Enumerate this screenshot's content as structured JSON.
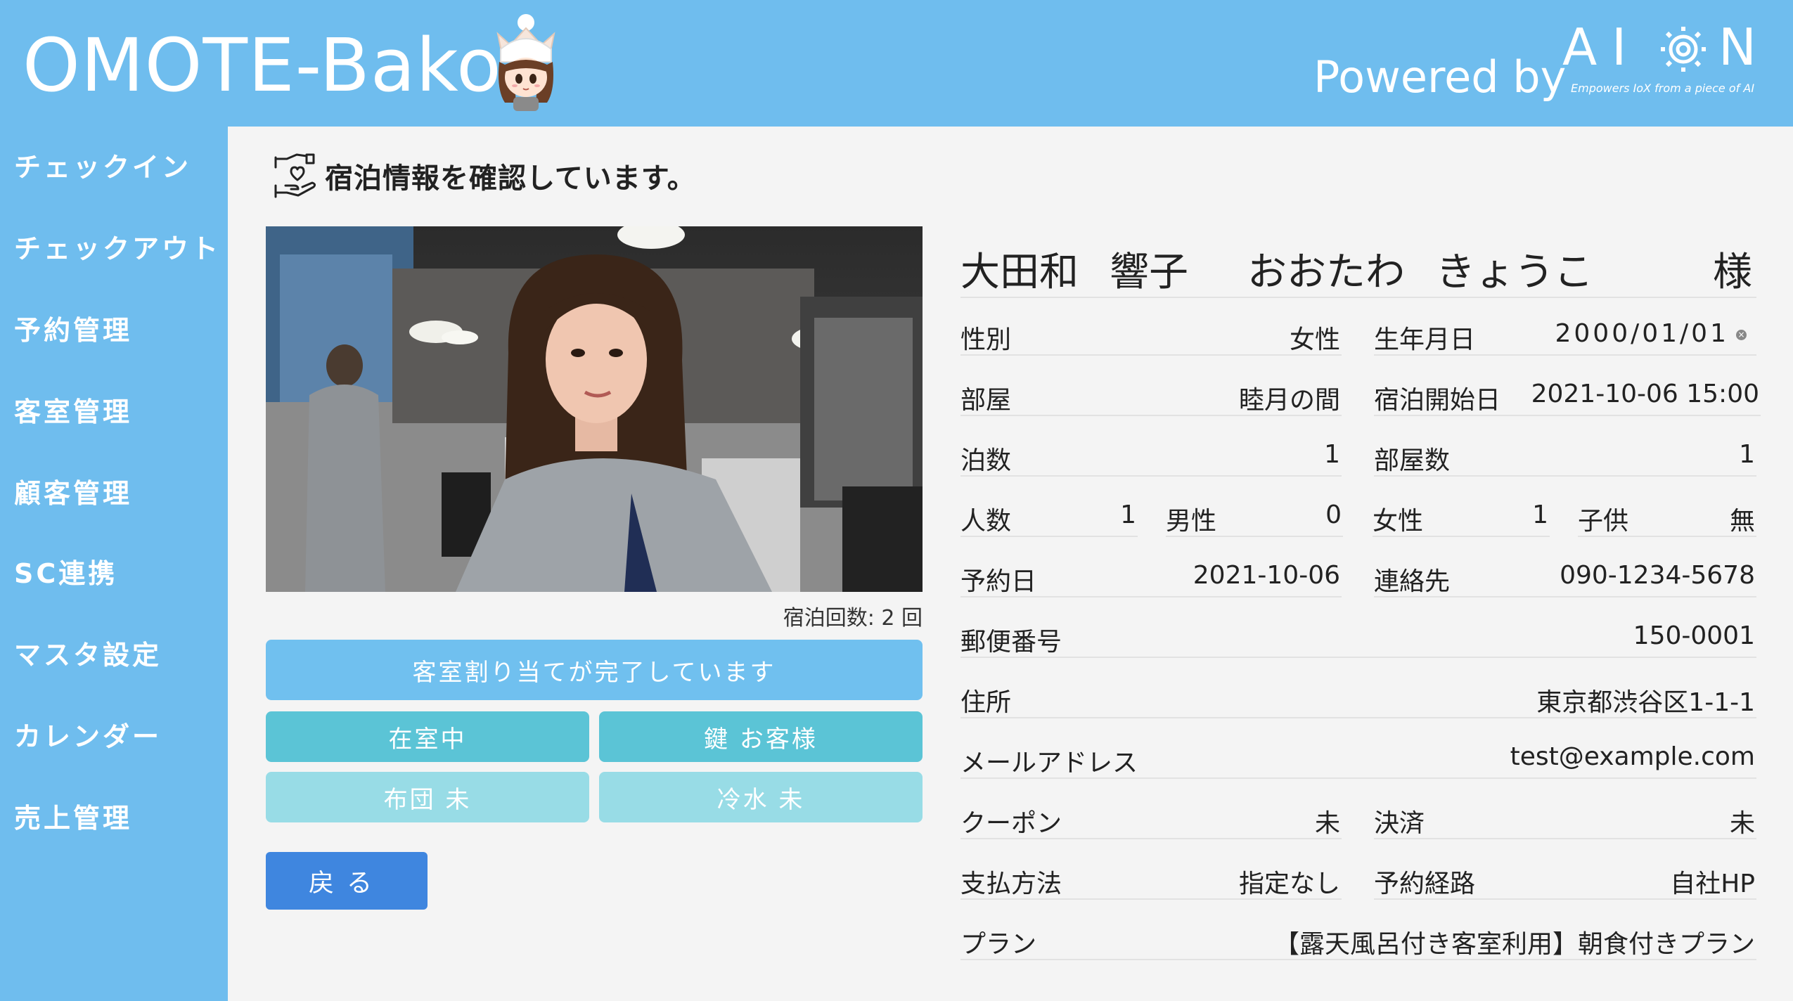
{
  "header": {
    "app_title": "OMOTE-Bako",
    "powered_by": "Powered by",
    "logo_text": "AION",
    "logo_tagline": "Empowers IoX from a piece of AI"
  },
  "sidebar": {
    "items": [
      {
        "label": "チェックイン"
      },
      {
        "label": "チェックアウト"
      },
      {
        "label": "予約管理"
      },
      {
        "label": "客室管理"
      },
      {
        "label": "顧客管理"
      },
      {
        "label": "SC連携"
      },
      {
        "label": "マスタ設定"
      },
      {
        "label": "カレンダー"
      },
      {
        "label": "売上管理"
      }
    ]
  },
  "main": {
    "heading": "宿泊情報を確認しています。",
    "stay_count": "宿泊回数: 2 回",
    "buttons": {
      "assign": "客室割り当てが完了しています",
      "in_room": "在室中",
      "key": "鍵 お客様",
      "futon": "布団 未",
      "water": "冷水 未",
      "back": "戻る"
    }
  },
  "guest": {
    "last_name": "大田和",
    "first_name": "響子",
    "last_name_kana": "おおたわ",
    "first_name_kana": "きょうこ",
    "honorific": "様",
    "gender_label": "性別",
    "gender": "女性",
    "birth_label": "生年月日",
    "birth": "2000/01/01",
    "room_label": "部屋",
    "room": "睦月の間",
    "start_label": "宿泊開始日",
    "start": "2021-10-06 15:00",
    "nights_label": "泊数",
    "nights": "1",
    "rooms_label": "部屋数",
    "rooms": "1",
    "people_label": "人数",
    "people": "1",
    "male_label": "男性",
    "male": "0",
    "female_label": "女性",
    "female": "1",
    "child_label": "子供",
    "child": "無",
    "reserve_date_label": "予約日",
    "reserve_date": "2021-10-06",
    "contact_label": "連絡先",
    "contact": "090-1234-5678",
    "postal_label": "郵便番号",
    "postal": "150-0001",
    "address_label": "住所",
    "address": "東京都渋谷区1-1-1",
    "email_label": "メールアドレス",
    "email": "test@example.com",
    "coupon_label": "クーポン",
    "coupon": "未",
    "payment_status_label": "決済",
    "payment_status": "未",
    "payment_method_label": "支払方法",
    "payment_method": "指定なし",
    "route_label": "予約経路",
    "route": "自社HP",
    "plan_label": "プラン",
    "plan": "【露天風呂付き客室利用】朝食付きプラン"
  },
  "colors": {
    "brand_blue": "#6fbdee",
    "teal": "#5bc4d6",
    "light_teal": "#98dce6",
    "back_button": "#3f86df"
  }
}
